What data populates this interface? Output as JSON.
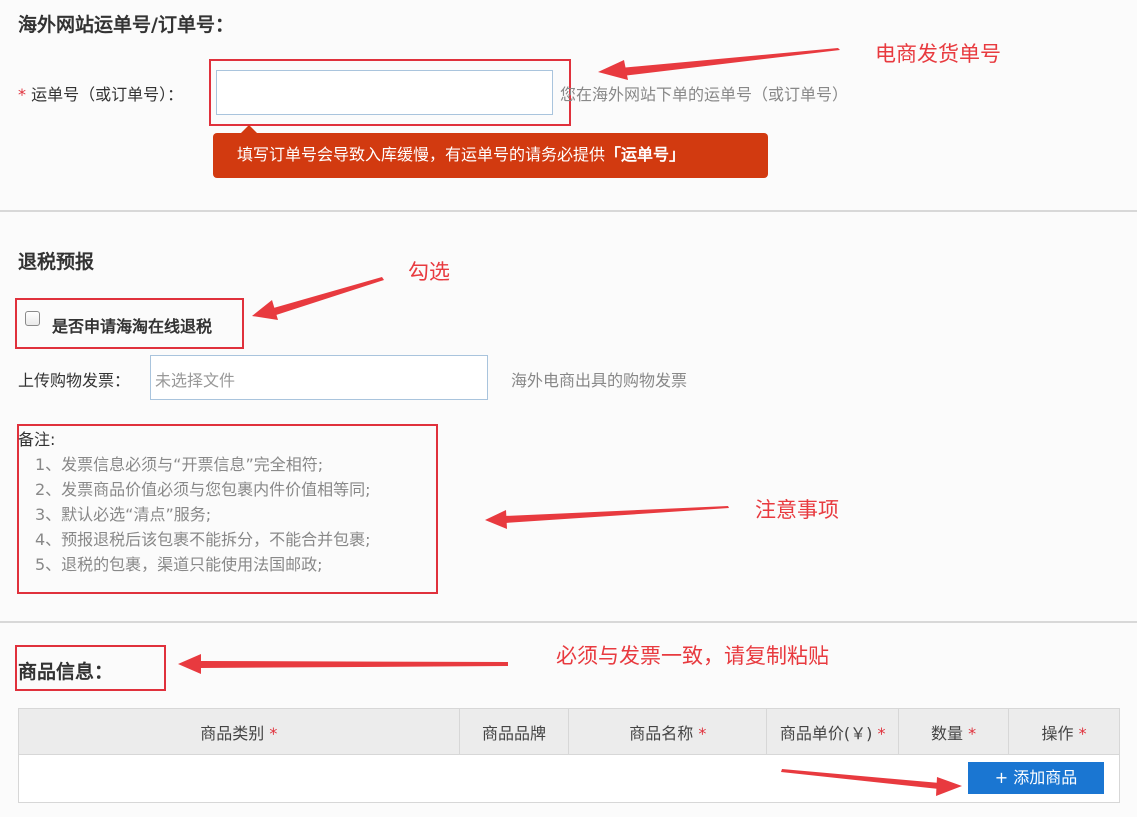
{
  "tracking": {
    "section_title": "海外网站运单号/订单号：",
    "required_mark": "*",
    "label": "运单号（或订单号）：",
    "input_value": "",
    "hint": "您在海外网站下单的运单号（或订单号）",
    "tooltip_text": "填写订单号会导致入库缓慢，有运单号的请务必提供",
    "tooltip_emphasis": "「运单号」"
  },
  "tax_refund": {
    "section_title": "退税预报",
    "checkbox_label": "是否申请海淘在线退税",
    "checkbox_checked": false,
    "upload_label": "上传购物发票：",
    "upload_placeholder": "未选择文件",
    "upload_hint": "海外电商出具的购物发票",
    "notes_title": "备注:",
    "notes": [
      "1、发票信息必须与“开票信息”完全相符;",
      "2、发票商品价值必须与您包裹内件价值相等同;",
      "3、默认必选“清点”服务;",
      "4、预报退税后该包裹不能拆分，不能合并包裹;",
      "5、退税的包裹，渠道只能使用法国邮政;"
    ]
  },
  "goods": {
    "section_title": "商品信息：",
    "columns": [
      {
        "label": "商品类别",
        "required": "*"
      },
      {
        "label": "商品品牌",
        "required": ""
      },
      {
        "label": "商品名称",
        "required": "*"
      },
      {
        "label": "商品单价(￥)",
        "required": "*"
      },
      {
        "label": "数量",
        "required": "*"
      },
      {
        "label": "操作",
        "required": "*"
      }
    ],
    "add_button_label": "+ 添加商品"
  },
  "annotations": {
    "tracking_note": "电商发货单号",
    "checkbox_note": "勾选",
    "notes_note": "注意事项",
    "goods_note": "必须与发票一致，请复制粘贴"
  },
  "colors": {
    "annotation_red": "#e83a3f",
    "tooltip_bg": "#d23a10",
    "button_blue": "#1a76d2"
  }
}
